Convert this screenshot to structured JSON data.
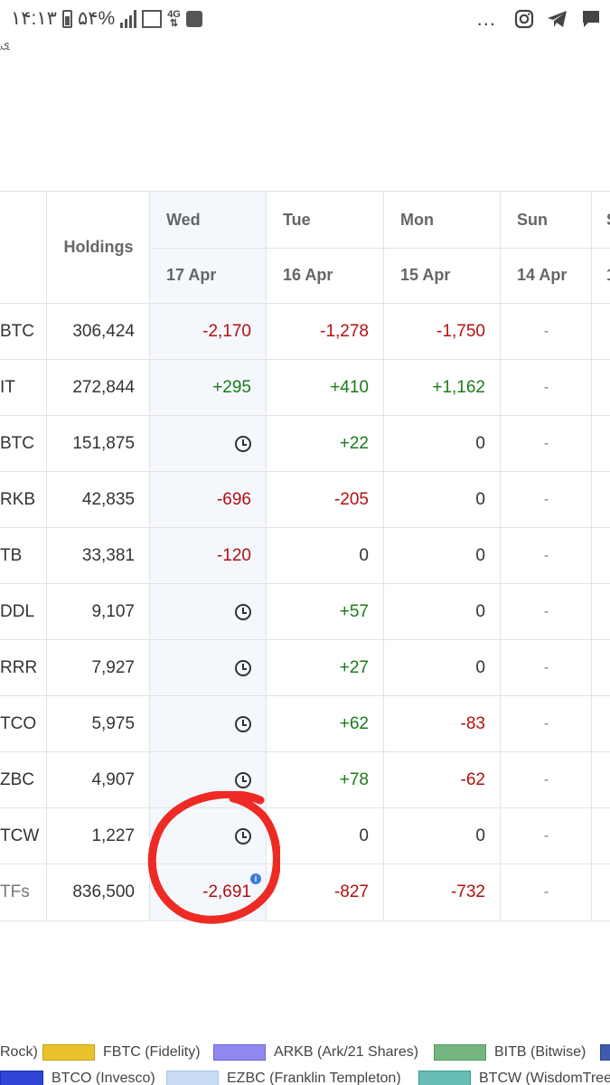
{
  "status_bar": {
    "time": "۱۴:۱۳",
    "battery": "۵۴%",
    "network": "4G",
    "more": "..."
  },
  "top_fragment": "ﯼ",
  "table": {
    "holdings_header": "Holdings",
    "days": [
      {
        "day": "Wed",
        "date": "17 Apr"
      },
      {
        "day": "Tue",
        "date": "16 Apr"
      },
      {
        "day": "Mon",
        "date": "15 Apr"
      },
      {
        "day": "Sun",
        "date": "14 Apr"
      },
      {
        "day": "S",
        "date": "1"
      }
    ],
    "rows": [
      {
        "ticker": "BTC",
        "holdings": "306,424",
        "wed": "-2,170",
        "tue": "-1,278",
        "mon": "-1,750",
        "sun": "-"
      },
      {
        "ticker": "IT",
        "holdings": "272,844",
        "wed": "+295",
        "tue": "+410",
        "mon": "+1,162",
        "sun": "-"
      },
      {
        "ticker": "BTC",
        "holdings": "151,875",
        "wed": "clock",
        "tue": "+22",
        "mon": "0",
        "sun": "-"
      },
      {
        "ticker": "RKB",
        "holdings": "42,835",
        "wed": "-696",
        "tue": "-205",
        "mon": "0",
        "sun": "-"
      },
      {
        "ticker": "TB",
        "holdings": "33,381",
        "wed": "-120",
        "tue": "0",
        "mon": "0",
        "sun": "-"
      },
      {
        "ticker": "DDL",
        "holdings": "9,107",
        "wed": "clock",
        "tue": "+57",
        "mon": "0",
        "sun": "-"
      },
      {
        "ticker": "RRR",
        "holdings": "7,927",
        "wed": "clock",
        "tue": "+27",
        "mon": "0",
        "sun": "-"
      },
      {
        "ticker": "TCO",
        "holdings": "5,975",
        "wed": "clock",
        "tue": "+62",
        "mon": "-83",
        "sun": "-"
      },
      {
        "ticker": "ZBC",
        "holdings": "4,907",
        "wed": "clock",
        "tue": "+78",
        "mon": "-62",
        "sun": "-"
      },
      {
        "ticker": "TCW",
        "holdings": "1,227",
        "wed": "clock",
        "tue": "0",
        "mon": "0",
        "sun": "-"
      }
    ],
    "total": {
      "ticker": "TFs",
      "holdings": "836,500",
      "wed": "-2,691",
      "tue": "-827",
      "mon": "-732",
      "sun": "-"
    },
    "info_badge": "i"
  },
  "legend": {
    "row1": [
      {
        "label": "Rock)",
        "color": ""
      },
      {
        "label": "FBTC (Fidelity)",
        "color": "#e8c22c"
      },
      {
        "label": "ARKB (Ark/21 Shares)",
        "color": "#9189f0"
      },
      {
        "label": "BITB (Bitwise)",
        "color": "#75b580"
      },
      {
        "label": "",
        "color": "#3f5ab0"
      }
    ],
    "row2": [
      {
        "label": "BTCO (Invesco)",
        "color": "#2f45d6"
      },
      {
        "label": "EZBC (Franklin Templeton)",
        "color": "#c8dcf4"
      },
      {
        "label": "BTCW (WisdomTree",
        "color": "#67bcb6"
      }
    ]
  },
  "colors": {
    "positive": "#1a7a1a",
    "negative": "#b30f0f",
    "highlight_column": "#f4f8fd",
    "annotation": "#ee2a24"
  }
}
